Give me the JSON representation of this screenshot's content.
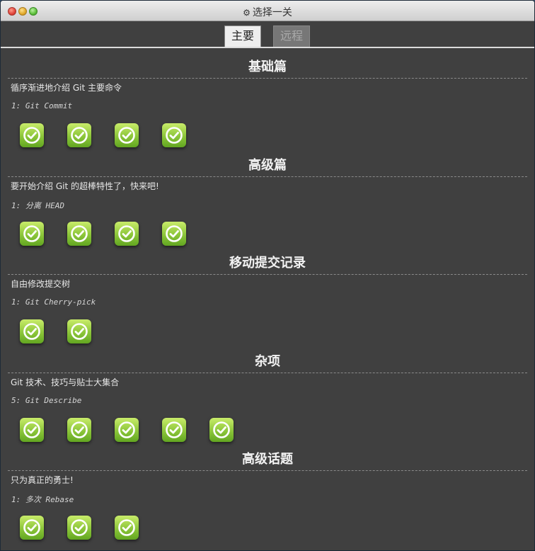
{
  "window": {
    "title": "选择一关",
    "title_icon": "gear-icon"
  },
  "tabs": [
    {
      "label": "主要",
      "active": true
    },
    {
      "label": "远程",
      "active": false
    }
  ],
  "sections": [
    {
      "title": "基础篇",
      "about": "循序渐进地介绍 Git 主要命令",
      "level_name": "1: Git Commit",
      "levels": 4
    },
    {
      "title": "高级篇",
      "about": "要开始介绍 Git 的超棒特性了，快来吧!",
      "level_name": "1: 分离 HEAD",
      "levels": 4
    },
    {
      "title": "移动提交记录",
      "about": "自由修改提交树",
      "level_name": "1: Git Cherry-pick",
      "levels": 2
    },
    {
      "title": "杂项",
      "about": "Git 技术、技巧与贴士大集合",
      "level_name": "5: Git Describe",
      "levels": 5
    },
    {
      "title": "高级话题",
      "about": "只为真正的勇士!",
      "level_name": "1: 多次 Rebase",
      "levels": 3
    }
  ],
  "colors": {
    "background": "#404040",
    "level_complete": "#8cc63a",
    "text": "#f2f2f2"
  },
  "level_icon": "checkmark-circle-icon"
}
